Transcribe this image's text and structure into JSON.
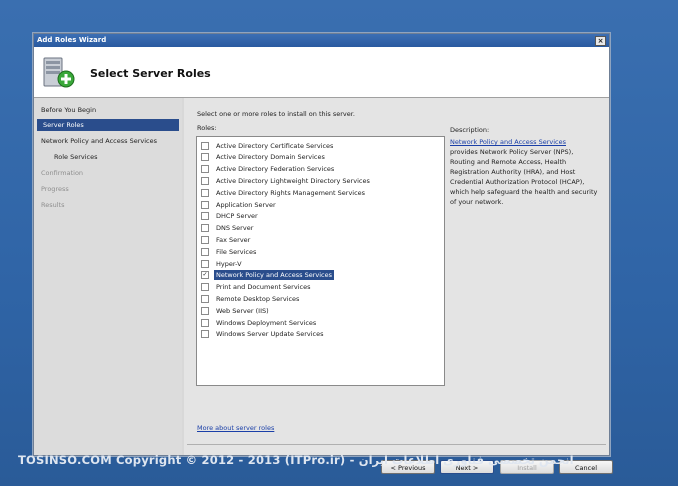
{
  "window": {
    "title": "Add Roles Wizard",
    "close_glyph": "×"
  },
  "header": {
    "title": "Select Server Roles",
    "icon": "server-roles-wizard-icon"
  },
  "nav": {
    "items": [
      {
        "label": "Before You Begin",
        "state": "normal"
      },
      {
        "label": "Server Roles",
        "state": "selected"
      },
      {
        "label": "Network Policy and Access Services",
        "state": "normal"
      },
      {
        "label": "Role Services",
        "state": "sub"
      },
      {
        "label": "Confirmation",
        "state": "disabled"
      },
      {
        "label": "Progress",
        "state": "disabled"
      },
      {
        "label": "Results",
        "state": "disabled"
      }
    ]
  },
  "content": {
    "instruction": "Select one or more roles to install on this server.",
    "roles_label": "Roles:",
    "roles": [
      {
        "label": "Active Directory Certificate Services",
        "checked": false
      },
      {
        "label": "Active Directory Domain Services",
        "checked": false
      },
      {
        "label": "Active Directory Federation Services",
        "checked": false
      },
      {
        "label": "Active Directory Lightweight Directory Services",
        "checked": false
      },
      {
        "label": "Active Directory Rights Management Services",
        "checked": false
      },
      {
        "label": "Application Server",
        "checked": false
      },
      {
        "label": "DHCP Server",
        "checked": false
      },
      {
        "label": "DNS Server",
        "checked": false
      },
      {
        "label": "Fax Server",
        "checked": false
      },
      {
        "label": "File Services",
        "checked": false
      },
      {
        "label": "Hyper-V",
        "checked": false
      },
      {
        "label": "Network Policy and Access Services",
        "checked": true,
        "selected": true
      },
      {
        "label": "Print and Document Services",
        "checked": false
      },
      {
        "label": "Remote Desktop Services",
        "checked": false
      },
      {
        "label": "Web Server (IIS)",
        "checked": false
      },
      {
        "label": "Windows Deployment Services",
        "checked": false
      },
      {
        "label": "Windows Server Update Services",
        "checked": false
      }
    ],
    "description_label": "Description:",
    "description_link": "Network Policy and Access Services",
    "description_text": "provides Network Policy Server (NPS), Routing and Remote Access, Health Registration Authority (HRA), and Host Credential Authorization Protocol (HCAP), which help safeguard the health and security of your network.",
    "more_link": "More about server roles"
  },
  "buttons": {
    "previous": "< Previous",
    "next": "Next >",
    "install": "Install",
    "cancel": "Cancel"
  },
  "footer": {
    "credit": "TOSINSO.COM    Copyright © 2012 - 2013 (ITPro.ir) - انجمن تخصصی فناوری اطلاعات ایران"
  },
  "colors": {
    "selection": "#2a4d8c",
    "link": "#1a3fa8",
    "desktop": "#2f64a6"
  }
}
